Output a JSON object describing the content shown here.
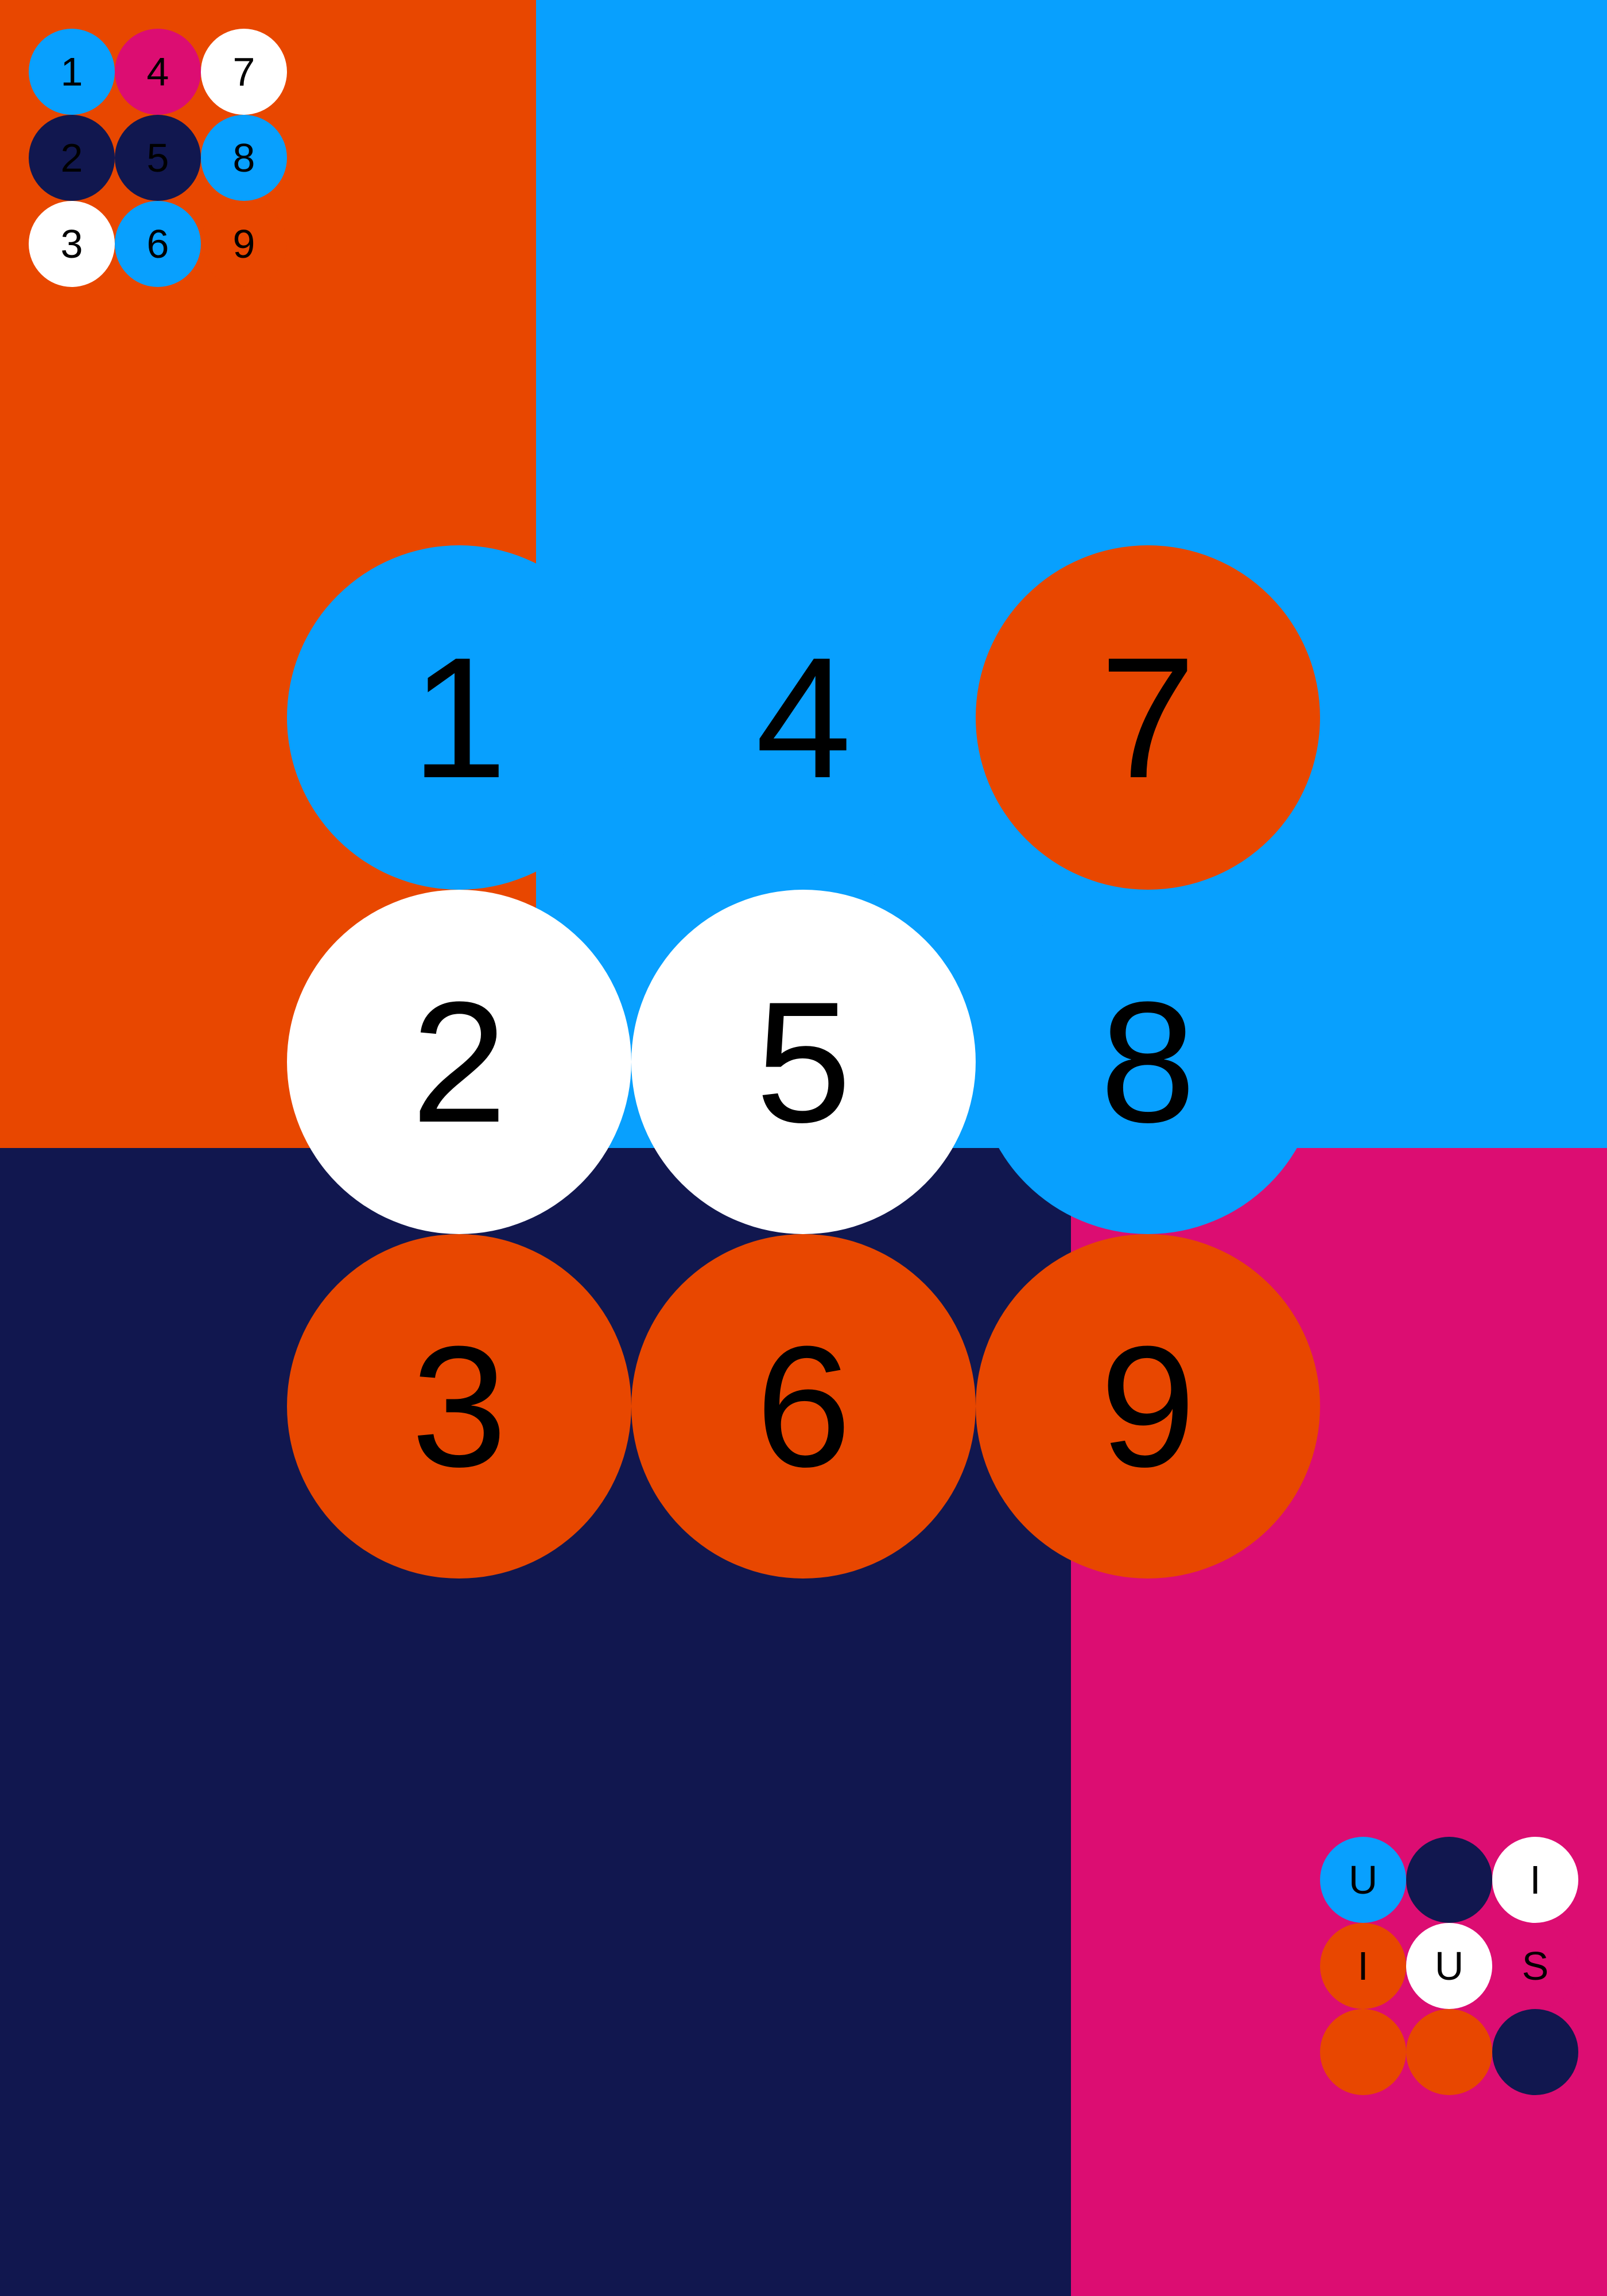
{
  "colors": {
    "orange": "#e84700",
    "sky_blue": "#08a0fe",
    "navy": "#11174f",
    "magenta": "#dc0d72",
    "white": "#ffffff",
    "text": "#000000"
  },
  "legend": {
    "cells": [
      {
        "label": "1",
        "fill": "sky_blue"
      },
      {
        "label": "4",
        "fill": "magenta"
      },
      {
        "label": "7",
        "fill": "white"
      },
      {
        "label": "2",
        "fill": "navy"
      },
      {
        "label": "5",
        "fill": "navy"
      },
      {
        "label": "8",
        "fill": "sky_blue"
      },
      {
        "label": "3",
        "fill": "white"
      },
      {
        "label": "6",
        "fill": "sky_blue"
      },
      {
        "label": "9",
        "fill": "orange"
      }
    ]
  },
  "grid": {
    "cells": [
      {
        "label": "1",
        "fill": "sky_blue"
      },
      {
        "label": "4",
        "fill": "sky_blue"
      },
      {
        "label": "7",
        "fill": "orange"
      },
      {
        "label": "2",
        "fill": "white"
      },
      {
        "label": "5",
        "fill": "white"
      },
      {
        "label": "8",
        "fill": "sky_blue"
      },
      {
        "label": "3",
        "fill": "orange"
      },
      {
        "label": "6",
        "fill": "orange"
      },
      {
        "label": "9",
        "fill": "orange"
      }
    ]
  },
  "logo": {
    "cells": [
      {
        "label": "U",
        "fill": "sky_blue"
      },
      {
        "label": "",
        "fill": "navy"
      },
      {
        "label": "I",
        "fill": "white"
      },
      {
        "label": "I",
        "fill": "orange"
      },
      {
        "label": "U",
        "fill": "white"
      },
      {
        "label": "S",
        "fill": "magenta"
      },
      {
        "label": "",
        "fill": "orange"
      },
      {
        "label": "",
        "fill": "orange"
      },
      {
        "label": "",
        "fill": "navy"
      }
    ]
  }
}
